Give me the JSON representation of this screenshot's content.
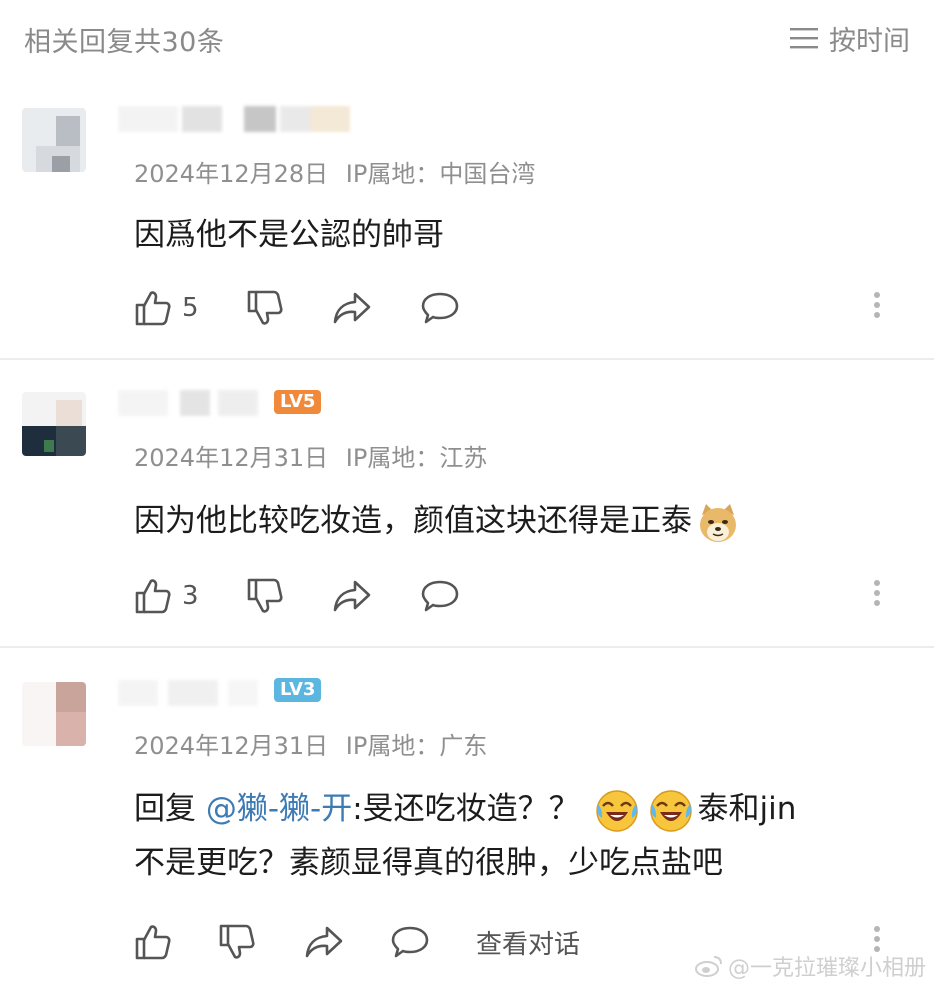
{
  "header": {
    "title": "相关回复共30条",
    "sort_label": "按时间"
  },
  "comments": [
    {
      "meta_date": "2024年12月28日",
      "meta_ip": "IP属地：中国台湾",
      "text": "因爲他不是公認的帥哥",
      "likes": "5"
    },
    {
      "level": "LV5",
      "meta_date": "2024年12月31日",
      "meta_ip": "IP属地：江苏",
      "text": "因为他比较吃妆造，颜值这块还得是正泰",
      "likes": "3",
      "emoji": "doge-emoji"
    },
    {
      "level": "LV3",
      "meta_date": "2024年12月31日",
      "meta_ip": "IP属地：广东",
      "reply_prefix": "回复",
      "mention": "@獭-獭-开",
      "text_part1": ":旻还吃妆造？？",
      "text_part2": "泰和jin",
      "text_line2": "不是更吃？素颜显得真的很肿，少吃点盐吧",
      "view_conversation": "查看对话",
      "emoji": "laugh-cry-emoji"
    }
  ],
  "watermark": "@一克拉璀璨小相册",
  "colors": {
    "accent_link": "#3d7bb5",
    "level5": "#f08a3a",
    "level3": "#5bb7e0"
  }
}
